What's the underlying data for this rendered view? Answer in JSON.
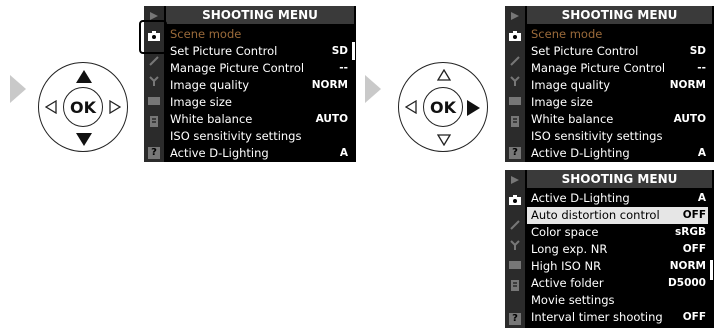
{
  "screens": {
    "left": {
      "title": "SHOOTING MENU",
      "items": [
        {
          "label": "Scene mode",
          "value": ""
        },
        {
          "label": "Set Picture Control",
          "value": "SD"
        },
        {
          "label": "Manage Picture Control",
          "value": "--"
        },
        {
          "label": "Image quality",
          "value": "NORM"
        },
        {
          "label": "Image size",
          "value": ""
        },
        {
          "label": "White balance",
          "value": "AUTO"
        },
        {
          "label": "ISO sensitivity settings",
          "value": ""
        },
        {
          "label": "Active D-Lighting",
          "value": "A"
        }
      ]
    },
    "top_right": {
      "title": "SHOOTING MENU",
      "items": [
        {
          "label": "Scene mode",
          "value": ""
        },
        {
          "label": "Set Picture Control",
          "value": "SD"
        },
        {
          "label": "Manage Picture Control",
          "value": "--"
        },
        {
          "label": "Image quality",
          "value": "NORM"
        },
        {
          "label": "Image size",
          "value": ""
        },
        {
          "label": "White balance",
          "value": "AUTO"
        },
        {
          "label": "ISO sensitivity settings",
          "value": ""
        },
        {
          "label": "Active D-Lighting",
          "value": "A"
        }
      ]
    },
    "bottom_right": {
      "title": "SHOOTING MENU",
      "items": [
        {
          "label": "Active D-Lighting",
          "value": "A"
        },
        {
          "label": "Auto distortion control",
          "value": "OFF"
        },
        {
          "label": "Color space",
          "value": "sRGB"
        },
        {
          "label": "Long exp. NR",
          "value": "OFF"
        },
        {
          "label": "High ISO NR",
          "value": "NORM"
        },
        {
          "label": "Active folder",
          "value": "D5000"
        },
        {
          "label": "Movie settings",
          "value": ""
        },
        {
          "label": "Interval timer shooting",
          "value": "OFF"
        }
      ]
    }
  },
  "selector": {
    "ok_label": "OK"
  },
  "help_label": "?",
  "colors": {
    "screen_bg": "#000000",
    "title_bg": "#3a3a3a",
    "selected_row": "#e6e6e6",
    "guide_arrow": "#c9c9c9"
  }
}
